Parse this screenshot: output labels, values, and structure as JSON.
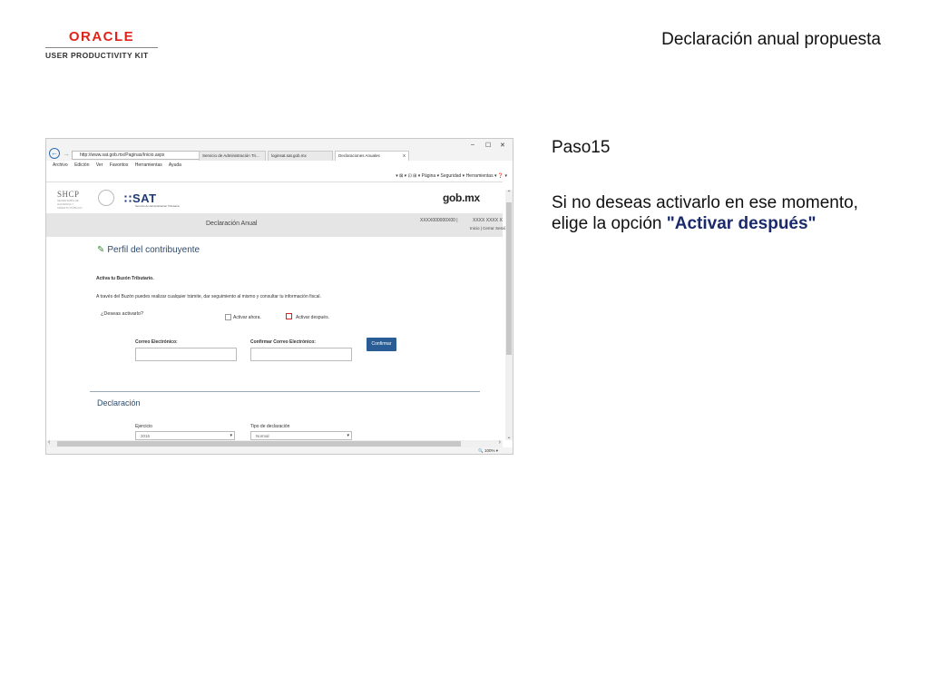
{
  "logo": {
    "brand": "ORACLE",
    "product": "USER PRODUCTIVITY KIT"
  },
  "document_title": "Declaración anual propuesta",
  "step_label": "Paso15",
  "instruction": {
    "text": "Si no deseas activarlo en ese momento, elige la opción ",
    "option": "\"Activar después\""
  },
  "browser": {
    "url": "http://www.sat.gob.mx/Paginas/Inicio.aspx",
    "tabs": [
      "Servicio de Administración Tri...",
      "loginsat.sat.gob.mx",
      "Declaraciones Anuales"
    ],
    "tab_close": "X",
    "window_controls": [
      "–",
      "☐",
      "✕"
    ],
    "menu": [
      "Archivo",
      "Edición",
      "Ver",
      "Favoritos",
      "Herramientas",
      "Ayuda"
    ],
    "commandbar": "▾  ⊠ ▾  ⊡  ⊞ ▾  Página ▾  Seguridad ▾  Herramientas ▾  ❓ ▾",
    "zoom": "🔍 100% ▾"
  },
  "site": {
    "shcp": "SHCP",
    "shcp_sub": "SECRETARÍA DE HACIENDA Y CRÉDITO PÚBLICO",
    "sat": "SAT",
    "sat_sub": "Servicio de Administración Tributaria",
    "gob": "gob.mx",
    "section_bar": "Declaración Anual",
    "rfc": "XXXX000000X00 |",
    "user": "XXXX XXXX X",
    "links": "Inicio | Cerrar Sesió"
  },
  "form": {
    "heading": "Perfil del contribuyente",
    "activa_title": "Activa tu Buzón Tributario.",
    "activa_desc": "A través del Buzón puedes realizar cualquier trámite, dar seguimiento al mismo y consultar tu información fiscal.",
    "question": "¿Deseas activarlo?",
    "option_now": "Activar ahora.",
    "option_later": "Activar después.",
    "email_label": "Correo Electrónico:",
    "confirm_email_label": "Confirmar Correo Electrónico:",
    "confirm_button": "Confirmar",
    "declaracion_heading": "Declaración",
    "ejercicio_label": "Ejercicio",
    "ejercicio_value": "2016",
    "tipo_label": "Tipo de declaración",
    "tipo_value": "Normal"
  }
}
